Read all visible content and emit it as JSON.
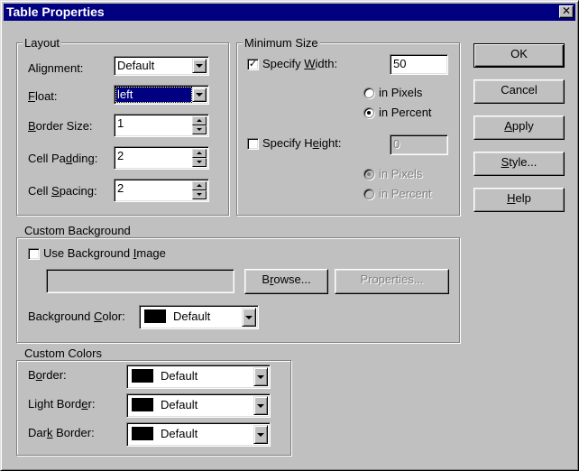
{
  "window": {
    "title": "Table Properties",
    "close_glyph": "✕"
  },
  "layout": {
    "legend": "Layout",
    "alignment": {
      "label_pre": "Alignment:",
      "value": "Default"
    },
    "float": {
      "label_u": "F",
      "label_rest": "loat:",
      "value": "left"
    },
    "border_size": {
      "label_u": "B",
      "label_rest": "order Size:",
      "value": "1"
    },
    "cell_padding": {
      "label_pre": "Cell Pa",
      "label_u": "d",
      "label_rest": "ding:",
      "value": "2"
    },
    "cell_spacing": {
      "label_pre": "Cell ",
      "label_u": "S",
      "label_rest": "pacing:",
      "value": "2"
    }
  },
  "minimum_size": {
    "legend": "Minimum Size",
    "specify_width": {
      "label_pre": "Specify ",
      "label_u": "W",
      "label_rest": "idth:",
      "checked": true,
      "value": "50"
    },
    "width_units": {
      "pixels": "in Pixels",
      "percent": "in Percent",
      "selected": "percent"
    },
    "specify_height": {
      "label_pre": "Specify H",
      "label_u": "e",
      "label_rest": "ight:",
      "checked": false,
      "value": "0"
    },
    "height_units": {
      "pixels": "in Pixels",
      "percent": "in Percent",
      "selected": "pixels"
    }
  },
  "custom_background": {
    "legend": "Custom Background",
    "use_image": {
      "label_pre": "Use Background ",
      "label_u": "I",
      "label_rest": "mage",
      "checked": false
    },
    "image_path": "",
    "browse": {
      "label_pre": "B",
      "label_u": "r",
      "label_rest": "owse..."
    },
    "properties": "Properties...",
    "bg_color": {
      "label_pre": "Background ",
      "label_u": "C",
      "label_rest": "olor:",
      "value": "Default"
    }
  },
  "custom_colors": {
    "legend": "Custom Colors",
    "border": {
      "label_pre": "B",
      "label_u": "o",
      "label_rest": "rder:",
      "value": "Default"
    },
    "light_border": {
      "label_pre": "Light Bord",
      "label_u": "e",
      "label_rest": "r:",
      "value": "Default"
    },
    "dark_border": {
      "label_pre": "Dar",
      "label_u": "k",
      "label_rest": " Border:",
      "value": "Default"
    }
  },
  "buttons": {
    "ok": "OK",
    "cancel": "Cancel",
    "apply": {
      "label_u": "A",
      "label_rest": "pply"
    },
    "style": {
      "label_u": "S",
      "label_rest": "tyle..."
    },
    "help": {
      "label_u": "H",
      "label_rest": "elp"
    }
  },
  "colors": {
    "titlebar": "#000080",
    "face": "#c0c0c0",
    "swatch": "#000000"
  },
  "icons": [
    "close-icon",
    "chevron-down-icon",
    "spin-up-icon",
    "spin-down-icon",
    "checkmark-icon"
  ]
}
